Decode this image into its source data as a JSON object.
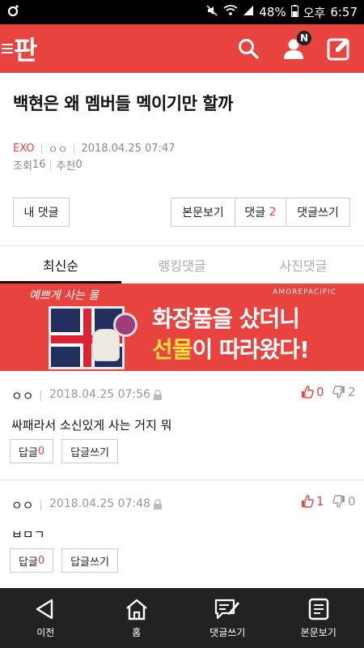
{
  "status_bar": {
    "left_icon": "o-notification-icon",
    "battery": "48%",
    "ampm": "오후",
    "time": "6:57"
  },
  "app_bar": {
    "logo_text": "판",
    "notification_badge": "N"
  },
  "article": {
    "title": "백현은 왜 멤버들 멕이기만 할까",
    "category": "EXO",
    "author": "ㅇㅇ",
    "date": "2018.04.25 07:47",
    "views_label": "조회",
    "views": "16",
    "recommend_label": "추천",
    "recommend": "0"
  },
  "actions": {
    "my_comments": "내 댓글",
    "view_post": "본문보기",
    "comments_label": "댓글",
    "comments_count": "2",
    "write_comment": "댓글쓰기"
  },
  "tabs": [
    {
      "label": "최신순",
      "active": true
    },
    {
      "label": "랭킹댓글",
      "active": false
    },
    {
      "label": "사진댓글",
      "active": false
    }
  ],
  "ad_banner": {
    "brand_left": "예쁘게 사는 몰",
    "brand_right": "AMOREPACIFIC",
    "line1": "화장품을 샀더니",
    "line2_highlight": "선물",
    "line2_rest": "이 따라왔다!"
  },
  "comments": [
    {
      "author": "ㅇㅇ",
      "date": "2018.04.25 07:56",
      "text": "싸패라서 소신있게 사는 거지 뭐",
      "up": "0",
      "down": "2",
      "reply_label": "답글",
      "reply_count": "0",
      "write_reply": "답글쓰기"
    },
    {
      "author": "ㅇㅇ",
      "date": "2018.04.25 07:48",
      "text": "ㅂㅁㄱ",
      "up": "1",
      "down": "0",
      "reply_label": "답글",
      "reply_count": "0",
      "write_reply": "답글쓰기"
    }
  ],
  "bottom_nav": [
    {
      "label": "이전",
      "icon": "back-icon"
    },
    {
      "label": "홈",
      "icon": "home-icon"
    },
    {
      "label": "댓글쓰기",
      "icon": "write-comment-icon"
    },
    {
      "label": "본문보기",
      "icon": "document-icon"
    }
  ],
  "colors": {
    "brand_red": "#e8433f",
    "status_bar": "#000000",
    "bottom_nav": "#222222",
    "ad_highlight": "#ffe040"
  }
}
